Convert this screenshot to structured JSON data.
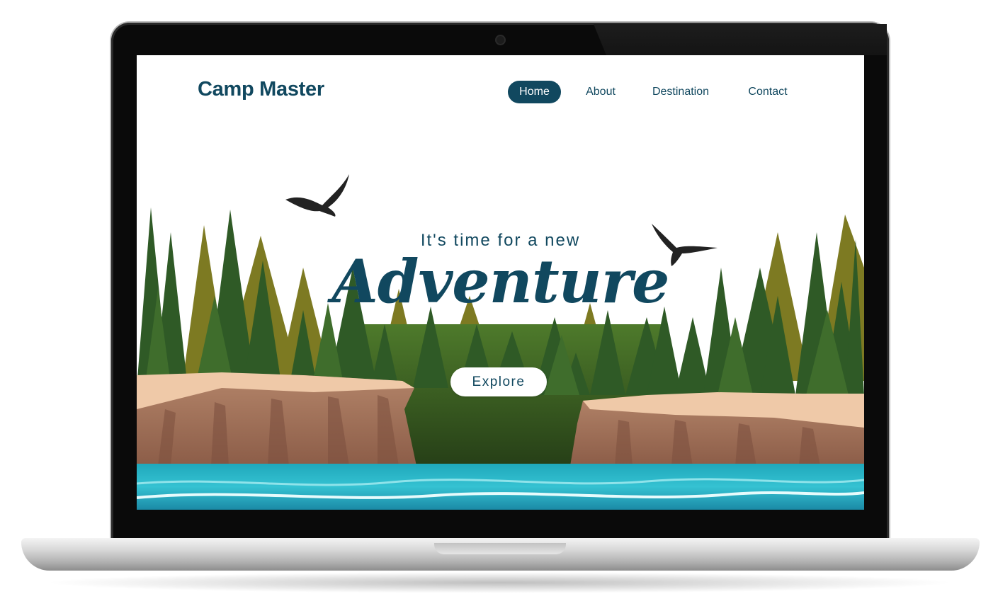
{
  "site": {
    "logo": "Camp Master",
    "nav": [
      {
        "label": "Home",
        "active": true
      },
      {
        "label": "About",
        "active": false
      },
      {
        "label": "Destination",
        "active": false
      },
      {
        "label": "Contact",
        "active": false
      }
    ]
  },
  "hero": {
    "subtitle": "It's time for a new",
    "title": "Adventure",
    "cta_label": "Explore"
  },
  "colors": {
    "brand": "#11485f",
    "water": "#2ab5c8",
    "cliff": "#a77860",
    "forest_dark": "#2f5a26",
    "forest_olive": "#7a7a23"
  },
  "illustration": {
    "birds": [
      "eagle-silhouette",
      "eagle-silhouette"
    ],
    "elements": [
      "pine-forest",
      "rock-cliffs",
      "river"
    ]
  }
}
